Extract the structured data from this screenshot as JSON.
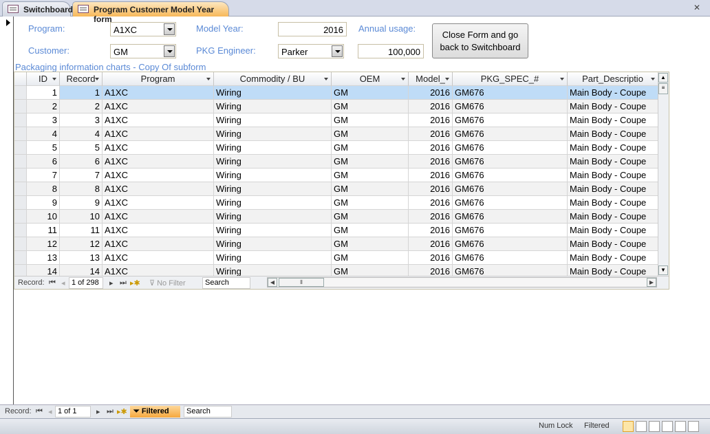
{
  "tabs": [
    {
      "label": "Switchboard"
    },
    {
      "label": "Program Customer Model Year form"
    }
  ],
  "form": {
    "program_label": "Program:",
    "program_value": "A1XC",
    "customer_label": "Customer:",
    "customer_value": "GM",
    "model_year_label": "Model Year:",
    "model_year_value": "2016",
    "pkg_engineer_label": "PKG Engineer:",
    "pkg_engineer_value": "Parker",
    "annual_usage_label": "Annual usage:",
    "annual_usage_value": "100,000",
    "close_button": "Close Form and go back to Switchboard",
    "subform_label": "Packaging information charts - Copy Of subform"
  },
  "grid": {
    "columns": [
      "ID",
      "Record",
      "Program",
      "Commodity / BU",
      "OEM",
      "Model_",
      "PKG_SPEC_#",
      "Part_Descriptio"
    ],
    "rows": [
      [
        "1",
        "1",
        "A1XC",
        "Wiring",
        "GM",
        "2016",
        "GM676",
        "Main Body - Coupe"
      ],
      [
        "2",
        "2",
        "A1XC",
        "Wiring",
        "GM",
        "2016",
        "GM676",
        "Main Body - Coupe"
      ],
      [
        "3",
        "3",
        "A1XC",
        "Wiring",
        "GM",
        "2016",
        "GM676",
        "Main Body - Coupe"
      ],
      [
        "4",
        "4",
        "A1XC",
        "Wiring",
        "GM",
        "2016",
        "GM676",
        "Main Body - Coupe"
      ],
      [
        "5",
        "5",
        "A1XC",
        "Wiring",
        "GM",
        "2016",
        "GM676",
        "Main Body - Coupe"
      ],
      [
        "6",
        "6",
        "A1XC",
        "Wiring",
        "GM",
        "2016",
        "GM676",
        "Main Body - Coupe"
      ],
      [
        "7",
        "7",
        "A1XC",
        "Wiring",
        "GM",
        "2016",
        "GM676",
        "Main Body - Coupe"
      ],
      [
        "8",
        "8",
        "A1XC",
        "Wiring",
        "GM",
        "2016",
        "GM676",
        "Main Body - Coupe"
      ],
      [
        "9",
        "9",
        "A1XC",
        "Wiring",
        "GM",
        "2016",
        "GM676",
        "Main Body - Coupe"
      ],
      [
        "10",
        "10",
        "A1XC",
        "Wiring",
        "GM",
        "2016",
        "GM676",
        "Main Body - Coupe"
      ],
      [
        "11",
        "11",
        "A1XC",
        "Wiring",
        "GM",
        "2016",
        "GM676",
        "Main Body - Coupe"
      ],
      [
        "12",
        "12",
        "A1XC",
        "Wiring",
        "GM",
        "2016",
        "GM676",
        "Main Body - Coupe"
      ],
      [
        "13",
        "13",
        "A1XC",
        "Wiring",
        "GM",
        "2016",
        "GM676",
        "Main Body - Coupe"
      ],
      [
        "14",
        "14",
        "A1XC",
        "Wiring",
        "GM",
        "2016",
        "GM676",
        "Main Body - Coupe"
      ]
    ]
  },
  "subnav": {
    "record_label": "Record:",
    "position": "1 of 298",
    "filter": "No Filter",
    "search": "Search"
  },
  "mainnav": {
    "record_label": "Record:",
    "position": "1 of 1",
    "filter": "Filtered",
    "search": "Search"
  },
  "status": {
    "num_lock": "Num Lock",
    "filtered": "Filtered"
  }
}
